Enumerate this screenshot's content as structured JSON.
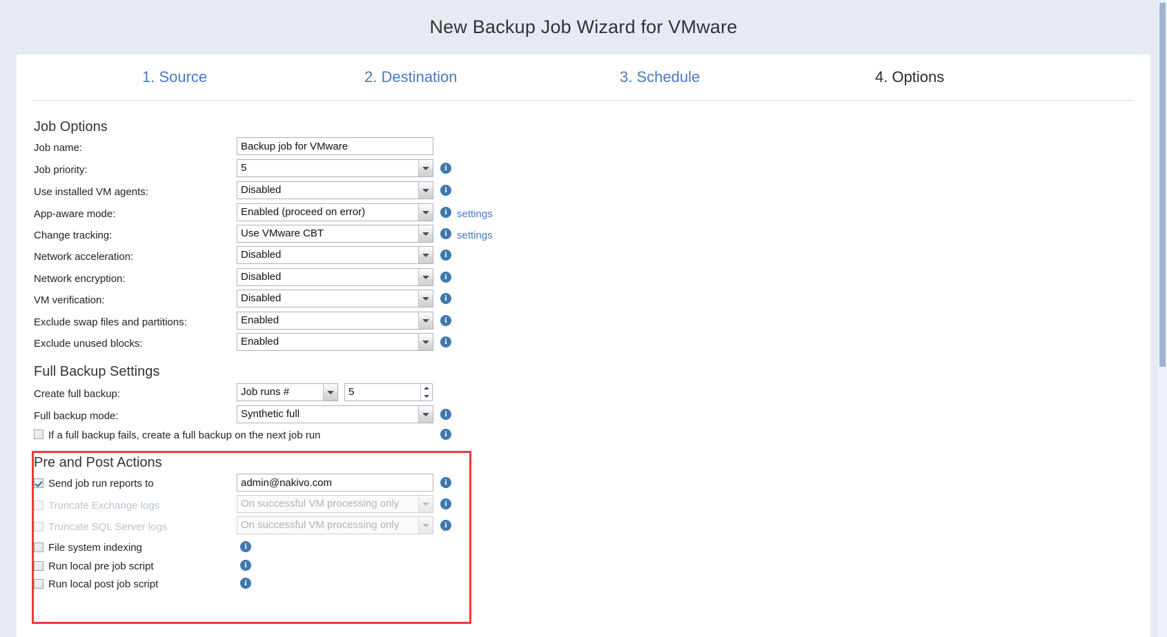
{
  "window": {
    "title": "New Backup Job Wizard for VMware"
  },
  "tabs": [
    {
      "label": "1. Source",
      "active": false
    },
    {
      "label": "2. Destination",
      "active": false
    },
    {
      "label": "3. Schedule",
      "active": false
    },
    {
      "label": "4. Options",
      "active": true
    }
  ],
  "sections": {
    "job_options": {
      "title": "Job Options",
      "job_name": {
        "label": "Job name:",
        "value": "Backup job for VMware",
        "placeholder": ""
      },
      "job_priority": {
        "label": "Job priority:",
        "value": "5",
        "info": "i"
      },
      "vm_agents": {
        "label": "Use installed VM agents:",
        "value": "Disabled",
        "info": "i"
      },
      "app_aware": {
        "label": "App-aware mode:",
        "value": "Enabled (proceed on error)",
        "info": "i",
        "settings_link": "settings"
      },
      "change_tracking": {
        "label": "Change tracking:",
        "value": "Use VMware CBT",
        "info": "i",
        "settings_link": "settings"
      },
      "network_acceleration": {
        "label": "Network acceleration:",
        "value": "Disabled",
        "info": "i"
      },
      "network_encryption": {
        "label": "Network encryption:",
        "value": "Disabled",
        "info": "i"
      },
      "vm_verification": {
        "label": "VM verification:",
        "value": "Disabled",
        "info": "i"
      },
      "exclude_swap": {
        "label": "Exclude swap files and partitions:",
        "value": "Enabled",
        "info": "i"
      },
      "exclude_unused": {
        "label": "Exclude unused blocks:",
        "value": "Enabled",
        "info": "i"
      }
    },
    "full_backup": {
      "title": "Full Backup Settings",
      "create_full_backup": {
        "label": "Create full backup:",
        "mode_value": "Job runs #",
        "count_value": "5"
      },
      "full_backup_mode": {
        "label": "Full backup mode:",
        "value": "Synthetic full",
        "info": "i"
      },
      "retry_full_backup": {
        "label": "If a full backup fails, create a full backup on the next job run",
        "checked": false,
        "info": "i"
      }
    },
    "pre_post_actions": {
      "title": "Pre and Post Actions",
      "items": [
        {
          "label": "Send job run reports to",
          "checked": true,
          "disabled": false,
          "control": "text",
          "value": "admin@nakivo.com",
          "info": "i"
        },
        {
          "label": "Truncate Exchange logs",
          "checked": false,
          "disabled": true,
          "control": "select",
          "value": "On successful VM processing only",
          "info": "i"
        },
        {
          "label": "Truncate SQL Server logs",
          "checked": false,
          "disabled": true,
          "control": "select",
          "value": "On successful VM processing only",
          "info": "i"
        },
        {
          "label": "File system indexing",
          "checked": false,
          "disabled": false,
          "control": "none",
          "value": "",
          "info": "i"
        },
        {
          "label": "Run local pre job script",
          "checked": false,
          "disabled": false,
          "control": "none",
          "value": "",
          "info": "i"
        },
        {
          "label": "Run local post job script",
          "checked": false,
          "disabled": false,
          "control": "none",
          "value": "",
          "info": "i"
        }
      ]
    }
  },
  "colors": {
    "link": "#4a77c4",
    "info_icon": "#3e78ae",
    "highlight_border": "#f03838",
    "page_bg": "#e6eaf2",
    "card_bg": "#ffffff"
  }
}
